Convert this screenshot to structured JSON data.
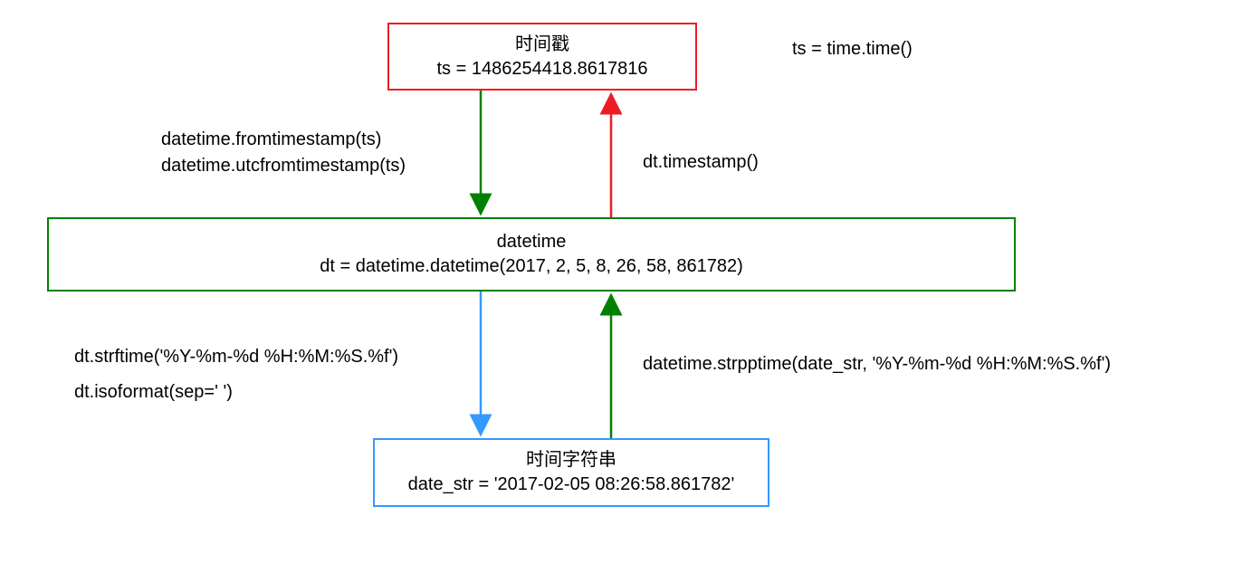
{
  "nodes": {
    "timestamp": {
      "title": "时间戳",
      "value": "ts = 1486254418.8617816",
      "side_note": "ts = time.time()"
    },
    "datetime": {
      "title": "datetime",
      "value": "dt = datetime.datetime(2017, 2, 5, 8, 26, 58, 861782)"
    },
    "date_string": {
      "title": "时间字符串",
      "value": "date_str = '2017-02-05 08:26:58.861782'"
    }
  },
  "edges": {
    "ts_to_dt_line1": "datetime.fromtimestamp(ts)",
    "ts_to_dt_line2": "datetime.utcfromtimestamp(ts)",
    "dt_to_ts": "dt.timestamp()",
    "dt_to_str_line1": "dt.strftime('%Y-%m-%d %H:%M:%S.%f')",
    "dt_to_str_line2": "dt.isoformat(sep=' ')",
    "str_to_dt": "datetime.strpptime(date_str, '%Y-%m-%d %H:%M:%S.%f')"
  },
  "colors": {
    "red": "#ED1C24",
    "green": "#008000",
    "blue": "#3399FF"
  }
}
